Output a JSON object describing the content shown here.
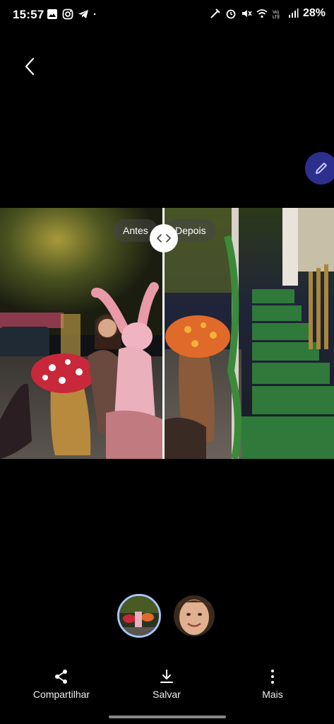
{
  "status_bar": {
    "time": "15:57",
    "battery": "28%",
    "left_icons": [
      "gallery-icon",
      "instagram-icon",
      "telegram-icon",
      "dot-icon"
    ],
    "right_icons": [
      "nfc-icon",
      "alarm-icon",
      "mute-icon",
      "wifi-icon",
      "volte-icon",
      "signal-icon"
    ]
  },
  "compare": {
    "before_label": "Antes",
    "after_label": "Depois"
  },
  "actions": {
    "share_label": "Compartilhar",
    "save_label": "Salvar",
    "more_label": "Mais"
  },
  "colors": {
    "background": "#000000",
    "edit_fab": "#2d2f8f",
    "thumb_selected_border": "#a8c7fa"
  }
}
